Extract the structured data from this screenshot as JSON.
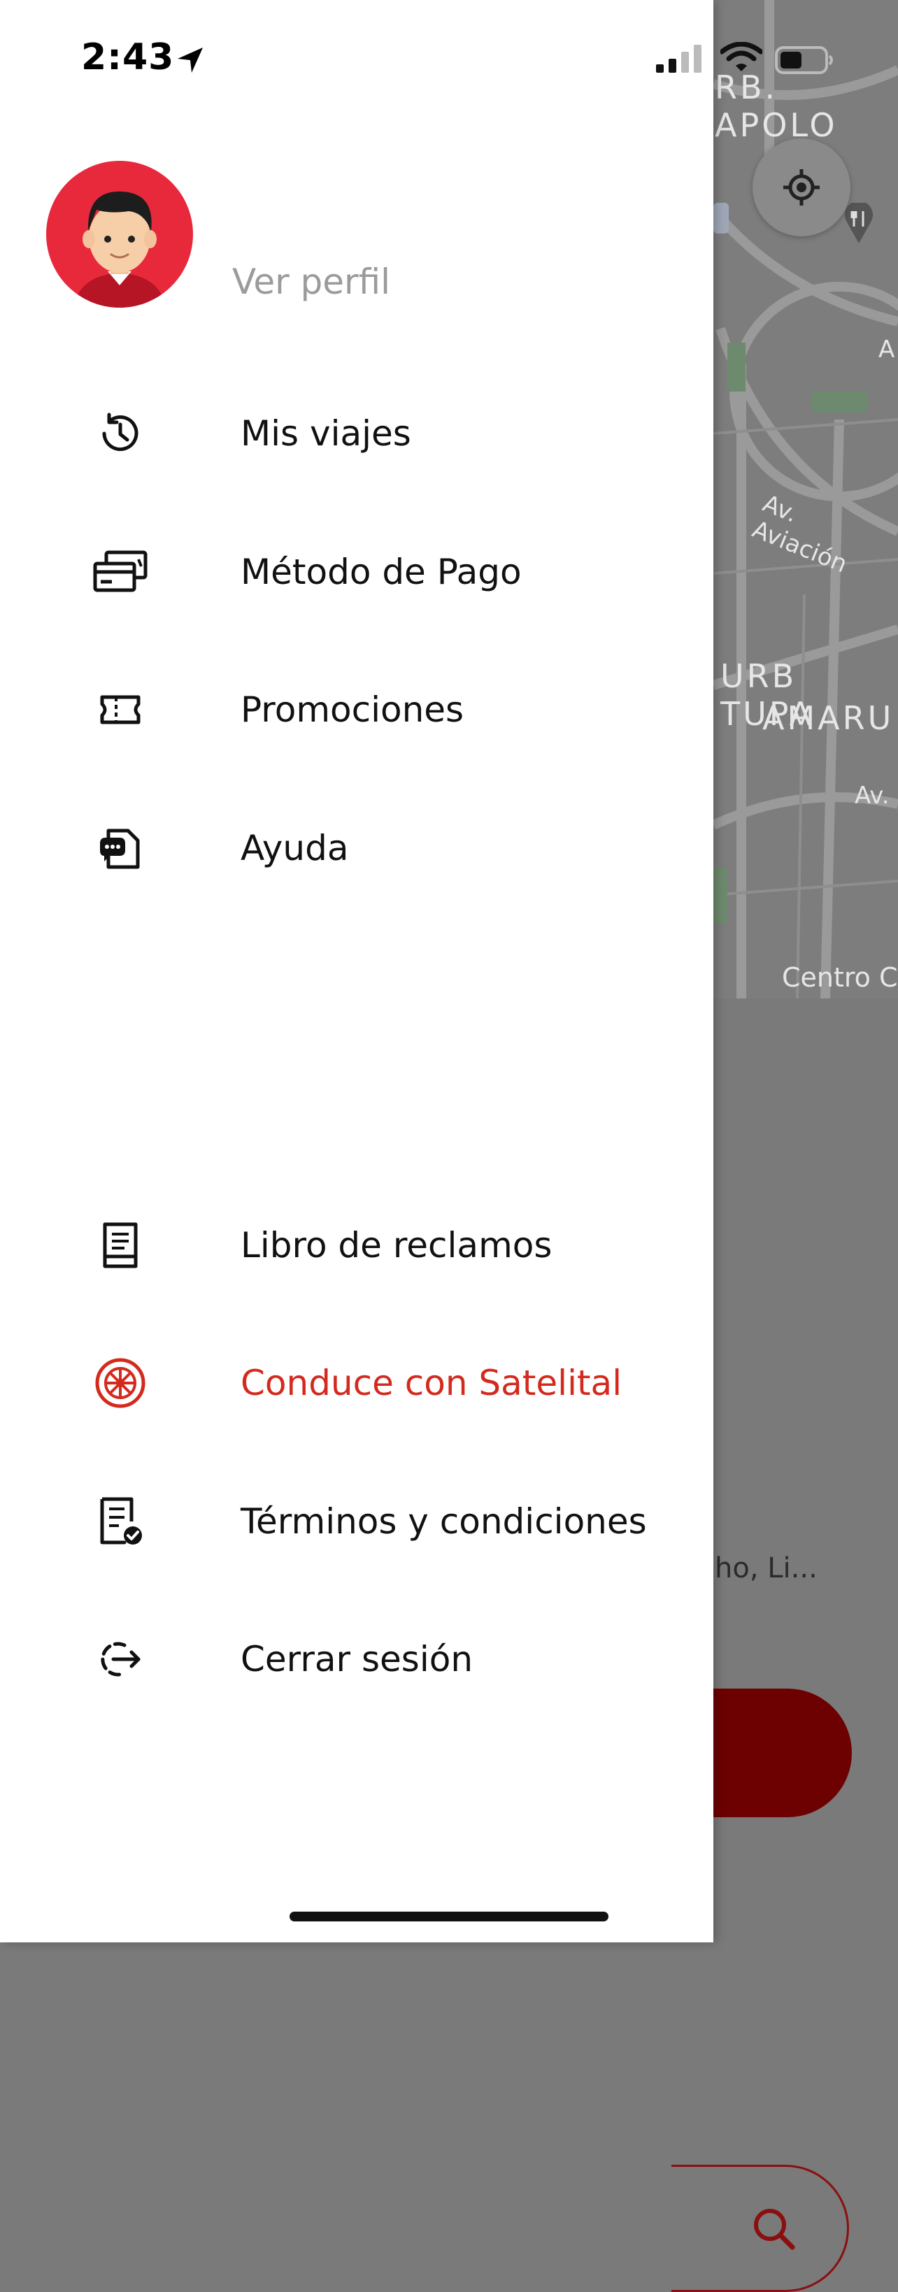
{
  "status_bar": {
    "time": "2:43",
    "icons": [
      "location-arrow-icon",
      "signal-icon",
      "wifi-icon",
      "battery-icon"
    ]
  },
  "drawer": {
    "avatar_icon": "user-avatar",
    "profile_link": "Ver perfil",
    "menu": [
      {
        "id": "mis-viajes",
        "label": "Mis viajes",
        "icon": "history-icon"
      },
      {
        "id": "metodo-pago",
        "label": "Método de Pago",
        "icon": "payment-cards-icon"
      },
      {
        "id": "promociones",
        "label": "Promociones",
        "icon": "ticket-icon"
      },
      {
        "id": "ayuda",
        "label": "Ayuda",
        "icon": "help-chat-icon"
      }
    ],
    "footer_menu": [
      {
        "id": "libro-reclamos",
        "label": "Libro de reclamos",
        "icon": "book-icon"
      },
      {
        "id": "conduce",
        "label": "Conduce con Satelital",
        "icon": "steering-wheel-icon",
        "color": "#d42a1e"
      },
      {
        "id": "terminos",
        "label": "Términos y condiciones",
        "icon": "document-check-icon"
      },
      {
        "id": "cerrar-sesion",
        "label": "Cerrar sesión",
        "icon": "logout-icon"
      }
    ]
  },
  "background": {
    "map_labels": [
      "RB. APOLO",
      "Av. Aviación",
      "URB TUPA",
      "AMARU",
      "Av.",
      "Centro C",
      "A"
    ],
    "address_text": "cho, Li...",
    "accent_color": "#6d0000"
  }
}
